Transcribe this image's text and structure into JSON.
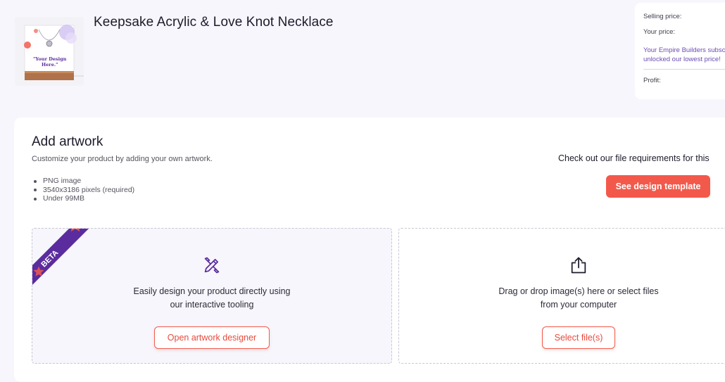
{
  "product": {
    "title": "Keepsake Acrylic & Love Knot Necklace",
    "thumbnail_caption": [
      "\"Your Design",
      "Here.\""
    ]
  },
  "pricing": {
    "selling_price_label": "Selling price:",
    "your_price_label": "Your price:",
    "subscription_note_line1": "Your Empire Builders subsc",
    "subscription_note_line2": "unlocked our lowest price!",
    "profit_label": "Profit:"
  },
  "artwork": {
    "title": "Add artwork",
    "subtitle": "Customize your product by adding your own artwork.",
    "requirements": [
      "PNG image",
      "3540x3186 pixels (required)",
      "Under 99MB"
    ],
    "file_req_hint": "Check out our file requirements for this",
    "template_button": "See design template"
  },
  "designer_panel": {
    "badge": "BETA",
    "text_line1": "Easily design your product directly using",
    "text_line2": "our interactive tooling",
    "button": "Open artwork designer",
    "icon": "design-tools-icon"
  },
  "upload_panel": {
    "text_line1": "Drag or drop image(s) here or select files",
    "text_line2": "from your computer",
    "button": "Select file(s)",
    "icon": "upload-icon"
  },
  "colors": {
    "accent": "#f2594b",
    "badge_purple": "#5b2c9e",
    "star": "#f2594b",
    "page_bg": "#f7f6fc"
  }
}
